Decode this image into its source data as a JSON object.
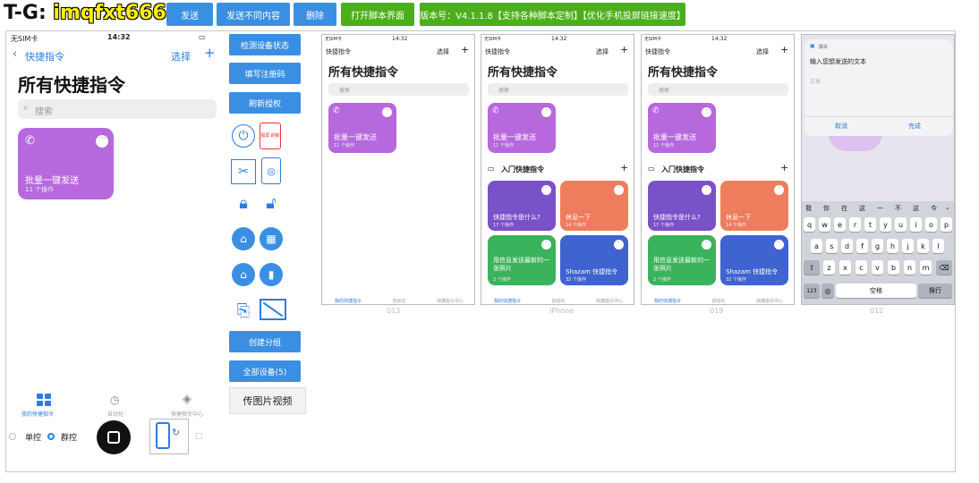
{
  "watermark": {
    "prefix": "T-G: ",
    "handle": "imqfxt666"
  },
  "toolbar": {
    "send": "发送",
    "send_diff": "发送不同内容",
    "delete": "删除",
    "open_script": "打开脚本界面",
    "version": "版本号：V4.1.1.8【支持各种脚本定制】【优化手机投屏链接速度】"
  },
  "main_phone": {
    "carrier": "无SIM卡",
    "time": "14:32",
    "back": "快捷指令",
    "select": "选择",
    "plus": "+",
    "title": "所有快捷指令",
    "search": "搜索",
    "card": {
      "title": "批量一键发送",
      "sub": "11 个操作"
    },
    "tabs": [
      "我的快捷指令",
      "自动化",
      "快捷指令中心"
    ]
  },
  "controls": {
    "check_status": "检测设备状态",
    "fill_code": "填写注册码",
    "refresh_auth": "刷新授权",
    "icon_label": "报屏 刷新",
    "create_group": "创建分组",
    "all_devices": "全部设备(5)",
    "upload_media": "传图片视频",
    "single": "单控",
    "group": "群控"
  },
  "phones": [
    {
      "carrier": "无SIM卡",
      "time": "14:32",
      "back": "快捷指令",
      "select": "选择",
      "title": "所有快捷指令",
      "search": "搜索",
      "card_title": "批量一键发送",
      "card_sub": "11 个操作",
      "caption": "013",
      "tabs": [
        "我的快捷指令",
        "自动化",
        "快捷指令中心"
      ]
    },
    {
      "carrier": "无SIM卡",
      "time": "14:32",
      "back": "快捷指令",
      "select": "选择",
      "title": "所有快捷指令",
      "search": "搜索",
      "card_title": "批量一键发送",
      "card_sub": "11 个操作",
      "caption": "IPhone",
      "section": "入门快捷指令",
      "starters": [
        {
          "title": "快捷指令是什么?",
          "sub": "17 个操作",
          "color": "#7a52c7"
        },
        {
          "title": "休息一下",
          "sub": "14 个操作",
          "color": "#ee7d5d"
        },
        {
          "title": "用信息发送最新的一张照片",
          "sub": "2 个操作",
          "color": "#3bb25c"
        },
        {
          "title": "Shazam 快捷指令",
          "sub": "32 个操作",
          "color": "#3f63cf"
        }
      ],
      "tabs": [
        "我的快捷指令",
        "自动化",
        "快捷指令中心"
      ]
    },
    {
      "carrier": "无SIM卡",
      "time": "14:32",
      "back": "快捷指令",
      "select": "选择",
      "title": "所有快捷指令",
      "search": "搜索",
      "card_title": "批量一键发送",
      "card_sub": "11 个操作",
      "caption": "019",
      "section": "入门快捷指令",
      "starters": [
        {
          "title": "快捷指令是什么?",
          "sub": "17 个操作",
          "color": "#7a52c7"
        },
        {
          "title": "休息一下",
          "sub": "14 个操作",
          "color": "#ee7d5d"
        },
        {
          "title": "用信息发送最新的一张照片",
          "sub": "2 个操作",
          "color": "#3bb25c"
        },
        {
          "title": "Shazam 快捷指令",
          "sub": "32 个操作",
          "color": "#3f63cf"
        }
      ],
      "tabs": [
        "我的快捷指令",
        "自动化",
        "快捷指令中心"
      ]
    },
    {
      "caption": "012",
      "app": "脚本",
      "prompt": "输入您想发送的文本",
      "placeholder": "文本",
      "cancel": "取消",
      "done": "完成",
      "candidates": [
        "我",
        "你",
        "在",
        "这",
        "一",
        "不",
        "这",
        "今"
      ],
      "row1": [
        "q",
        "w",
        "e",
        "r",
        "t",
        "y",
        "u",
        "i",
        "o",
        "p"
      ],
      "row2": [
        "a",
        "s",
        "d",
        "f",
        "g",
        "h",
        "j",
        "k",
        "l"
      ],
      "row3": [
        "z",
        "x",
        "c",
        "v",
        "b",
        "n",
        "m"
      ],
      "num": "123",
      "space": "空格",
      "return": "换行"
    }
  ]
}
